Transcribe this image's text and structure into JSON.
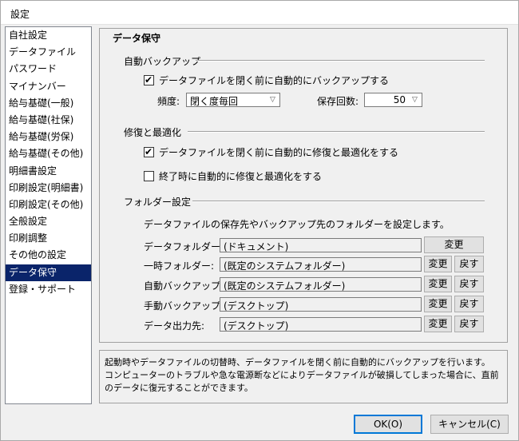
{
  "window": {
    "title": "設定"
  },
  "sidebar": {
    "items": [
      {
        "label": "自社設定"
      },
      {
        "label": "データファイル"
      },
      {
        "label": "パスワード"
      },
      {
        "label": "マイナンバー"
      },
      {
        "label": "給与基礎(一般)"
      },
      {
        "label": "給与基礎(社保)"
      },
      {
        "label": "給与基礎(労保)"
      },
      {
        "label": "給与基礎(その他)"
      },
      {
        "label": "明細書設定"
      },
      {
        "label": "印刷設定(明細書)"
      },
      {
        "label": "印刷設定(その他)"
      },
      {
        "label": "全般設定"
      },
      {
        "label": "印刷調整"
      },
      {
        "label": "その他の設定"
      },
      {
        "label": "データ保守"
      },
      {
        "label": "登録・サポート"
      }
    ],
    "selected_index": 14
  },
  "main": {
    "section_title": "データ保守",
    "auto_backup": {
      "group_label": "自動バックアップ",
      "check_label": "データファイルを閉く前に自動的にバックアップする",
      "checked": true,
      "frequency_label": "頻度:",
      "frequency_value": "閉く度毎回",
      "count_label": "保存回数:",
      "count_value": "50"
    },
    "repair": {
      "group_label": "修復と最適化",
      "check1_label": "データファイルを閉く前に自動的に修復と最適化をする",
      "check1_checked": true,
      "check2_label": "終了時に自動的に修復と最適化をする",
      "check2_checked": false
    },
    "folders": {
      "group_label": "フォルダー設定",
      "description": "データファイルの保存先やバックアップ先のフォルダーを設定します。",
      "change_label": "変更",
      "reset_label": "戻す",
      "rows": [
        {
          "label": "データフォルダー:",
          "value": "(ドキュメント)"
        },
        {
          "label": "一時フォルダー:",
          "value": "(既定のシステムフォルダー)"
        },
        {
          "label": "自動バックアップ:",
          "value": "(既定のシステムフォルダー)"
        },
        {
          "label": "手動バックアップ:",
          "value": "(デスクトップ)"
        },
        {
          "label": "データ出力先:",
          "value": "(デスクトップ)"
        }
      ]
    }
  },
  "help_text": {
    "line1": "起動時やデータファイルの切替時、データファイルを閉く前に自動的にバックアップを行います。",
    "line2": "コンピューターのトラブルや急な電源断などによりデータファイルが破損してしまった場合に、直前",
    "line3": "のデータに復元することができます。"
  },
  "footer": {
    "ok_label": "OK(O)",
    "cancel_label": "キャンセル(C)"
  },
  "icons": {
    "check": "check-mark-icon",
    "dropdown": "chevron-down-icon"
  },
  "colors": {
    "selection": "#0a246a",
    "default_button_border": "#0078d7"
  }
}
